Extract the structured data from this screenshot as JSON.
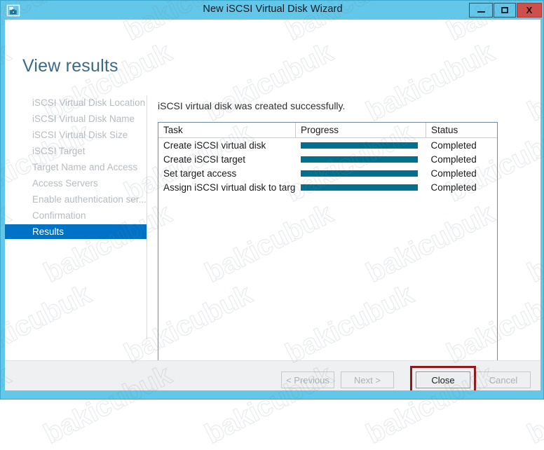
{
  "window": {
    "title": "New iSCSI Virtual Disk Wizard",
    "icon": "server-disk-icon",
    "accent_color": "#62c7e8",
    "controls": {
      "minimize_label": "–",
      "maximize_label": "□",
      "close_label": "X"
    }
  },
  "page": {
    "heading": "View results",
    "message": "iSCSI virtual disk was created successfully."
  },
  "sidebar": {
    "items": [
      {
        "label": "iSCSI Virtual Disk Location",
        "selected": false
      },
      {
        "label": "iSCSI Virtual Disk Name",
        "selected": false
      },
      {
        "label": "iSCSI Virtual Disk Size",
        "selected": false
      },
      {
        "label": "iSCSI Target",
        "selected": false
      },
      {
        "label": "Target Name and Access",
        "selected": false
      },
      {
        "label": "Access Servers",
        "selected": false
      },
      {
        "label": "Enable authentication ser...",
        "selected": false
      },
      {
        "label": "Confirmation",
        "selected": false
      },
      {
        "label": "Results",
        "selected": true
      }
    ],
    "selected_color": "#0072c6"
  },
  "results_table": {
    "columns": [
      "Task",
      "Progress",
      "Status"
    ],
    "progress_color": "#00708f",
    "rows": [
      {
        "task": "Create iSCSI virtual disk",
        "progress": 100,
        "status": "Completed"
      },
      {
        "task": "Create iSCSI target",
        "progress": 100,
        "status": "Completed"
      },
      {
        "task": "Set target access",
        "progress": 100,
        "status": "Completed"
      },
      {
        "task": "Assign iSCSI virtual disk to target",
        "progress": 100,
        "status": "Completed"
      }
    ]
  },
  "footer": {
    "previous_label": "< Previous",
    "next_label": "Next >",
    "close_label": "Close",
    "cancel_label": "Cancel",
    "highlight_color": "#8e1b1b"
  },
  "watermark": {
    "text": "bakicubuk"
  }
}
